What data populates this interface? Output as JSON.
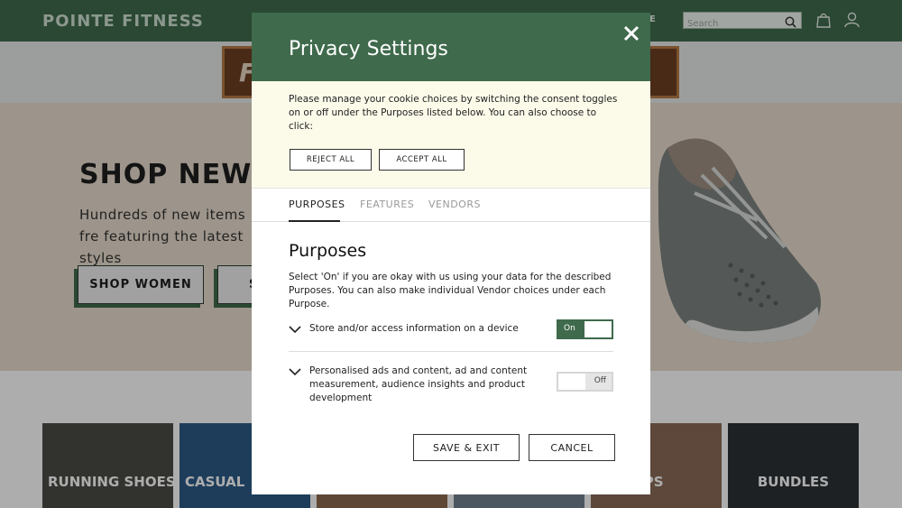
{
  "header": {
    "brand": "POINTE FITNESS",
    "nav_fragment": "E",
    "search_placeholder": "Search"
  },
  "promo": {
    "text_fragment": "F"
  },
  "hero": {
    "title": "SHOP NEW A",
    "subtitle": "Hundreds of new items fre featuring the latest styles",
    "buttons": [
      {
        "label": "SHOP WOMEN"
      },
      {
        "label": "S"
      }
    ]
  },
  "categories": [
    {
      "label": "RUNNING SHOES",
      "color": "#4a4a44"
    },
    {
      "label": "CASUAL",
      "color": "#2b5a86"
    },
    {
      "label": "",
      "color": "#8b6b4e"
    },
    {
      "label": "",
      "color": "#6f7f8e"
    },
    {
      "label": "OPS",
      "color": "#8a6a58"
    },
    {
      "label": "BUNDLES",
      "color": "#2c3236"
    }
  ],
  "modal": {
    "title": "Privacy Settings",
    "intro": "Please manage your cookie choices by switching the consent toggles on or off under the Purposes listed below. You can also choose to click:",
    "reject_label": "REJECT ALL",
    "accept_label": "ACCEPT ALL",
    "tabs": [
      {
        "label": "PURPOSES",
        "active": true
      },
      {
        "label": "FEATURES",
        "active": false
      },
      {
        "label": "VENDORS",
        "active": false
      }
    ],
    "heading": "Purposes",
    "description": "Select 'On' if you are okay with us using your data for the described Purposes. You can also make individual Vendor choices under each Purpose.",
    "purposes": [
      {
        "label": "Store and/or access information on a device",
        "state": "On"
      },
      {
        "label": "Personalised ads and content, ad and content measurement, audience insights and product development",
        "state": "Off"
      }
    ],
    "save_label": "SAVE & EXIT",
    "cancel_label": "CANCEL"
  },
  "colors": {
    "brand_green": "#3f6a4c",
    "intro_bg": "#fcfbea",
    "hero_bg": "#e7dccd"
  }
}
